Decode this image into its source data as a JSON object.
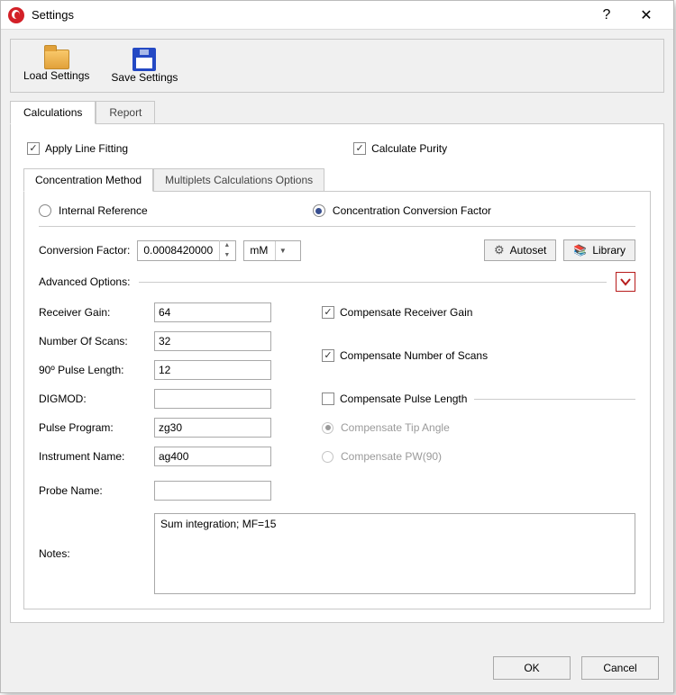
{
  "window": {
    "title": "Settings"
  },
  "toolbar": {
    "load": "Load Settings",
    "save": "Save Settings"
  },
  "tabs": {
    "calc": "Calculations",
    "report": "Report"
  },
  "top_checks": {
    "line_fitting": "Apply Line Fitting",
    "purity": "Calculate Purity"
  },
  "inner_tabs": {
    "conc": "Concentration Method",
    "mult": "Multiplets Calculations Options"
  },
  "method": {
    "internal": "Internal Reference",
    "ccf": "Concentration Conversion Factor"
  },
  "cf": {
    "label": "Conversion Factor:",
    "value": "0.0008420000",
    "unit": "mM",
    "autoset": "Autoset",
    "library": "Library"
  },
  "adv_label": "Advanced Options:",
  "fields": {
    "receiver_lbl": "Receiver Gain:",
    "receiver_val": "64",
    "nscans_lbl": "Number Of Scans:",
    "nscans_val": "32",
    "pulse_lbl": "90º Pulse Length:",
    "pulse_val": "12",
    "digmod_lbl": "DIGMOD:",
    "digmod_val": "",
    "pprog_lbl": "Pulse Program:",
    "pprog_val": "zg30",
    "inst_lbl": "Instrument Name:",
    "inst_val": "ag400",
    "probe_lbl": "Probe Name:",
    "probe_val": "",
    "notes_lbl": "Notes:",
    "notes_val": "Sum integration; MF=15"
  },
  "right_checks": {
    "comp_rg": "Compensate Receiver Gain",
    "comp_ns": "Compensate Number of Scans",
    "comp_pl": "Compensate Pulse Length",
    "comp_tip": "Compensate Tip Angle",
    "comp_pw": "Compensate PW(90)"
  },
  "footer": {
    "ok": "OK",
    "cancel": "Cancel"
  }
}
